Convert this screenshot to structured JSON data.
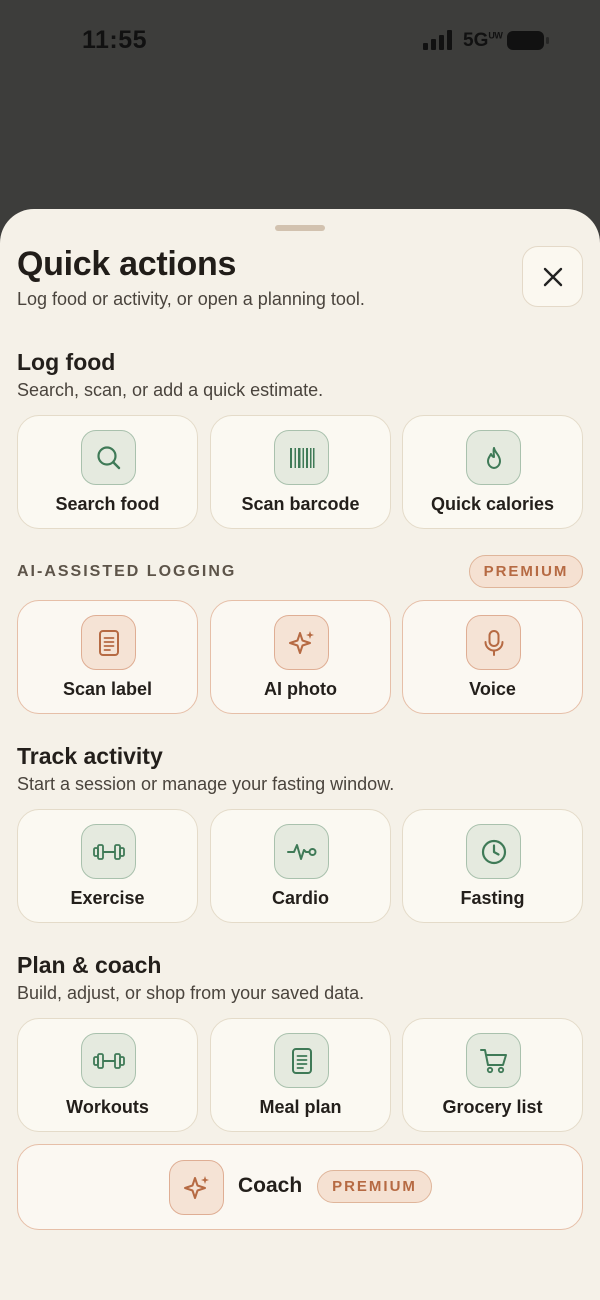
{
  "status": {
    "time": "11:55",
    "network": "5G",
    "network_sub": "UW"
  },
  "sheet": {
    "title": "Quick actions",
    "subtitle": "Log food or activity, or open a planning tool.",
    "close_icon": "close-icon"
  },
  "log_food": {
    "title": "Log food",
    "subtitle": "Search, scan, or add a quick estimate.",
    "tiles": [
      {
        "label": "Search food",
        "icon": "search-icon"
      },
      {
        "label": "Scan barcode",
        "icon": "barcode-icon"
      },
      {
        "label": "Quick calories",
        "icon": "flame-icon"
      }
    ]
  },
  "ai_logging": {
    "eyebrow": "AI-ASSISTED LOGGING",
    "badge": "PREMIUM",
    "tiles": [
      {
        "label": "Scan label",
        "icon": "document-icon"
      },
      {
        "label": "AI photo",
        "icon": "sparkle-icon"
      },
      {
        "label": "Voice",
        "icon": "microphone-icon"
      }
    ]
  },
  "track_activity": {
    "title": "Track activity",
    "subtitle": "Start a session or manage your fasting window.",
    "tiles": [
      {
        "label": "Exercise",
        "icon": "dumbbell-icon"
      },
      {
        "label": "Cardio",
        "icon": "heartbeat-icon"
      },
      {
        "label": "Fasting",
        "icon": "clock-icon"
      }
    ]
  },
  "plan_coach": {
    "title": "Plan & coach",
    "subtitle": "Build, adjust, or shop from your saved data.",
    "tiles": [
      {
        "label": "Workouts",
        "icon": "dumbbell-icon"
      },
      {
        "label": "Meal plan",
        "icon": "document-icon"
      },
      {
        "label": "Grocery list",
        "icon": "cart-icon"
      }
    ],
    "coach": {
      "label": "Coach",
      "badge": "PREMIUM",
      "icon": "sparkle-icon"
    }
  },
  "colors": {
    "sheet_bg": "#f5f1e8",
    "green_accent": "#3f7a57",
    "orange_accent": "#b66a43",
    "backdrop": "#3d3d3b"
  }
}
